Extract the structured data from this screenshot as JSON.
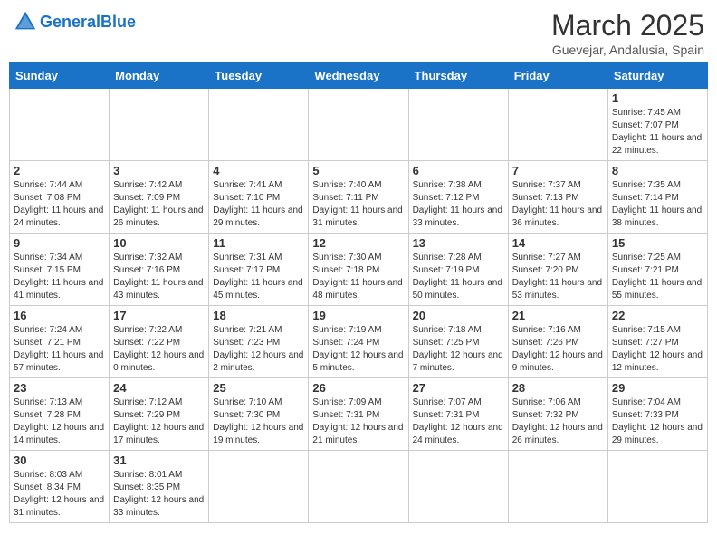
{
  "header": {
    "logo_text_general": "General",
    "logo_text_blue": "Blue",
    "month": "March 2025",
    "location": "Guevejar, Andalusia, Spain"
  },
  "days_of_week": [
    "Sunday",
    "Monday",
    "Tuesday",
    "Wednesday",
    "Thursday",
    "Friday",
    "Saturday"
  ],
  "weeks": [
    [
      {
        "day": "",
        "info": ""
      },
      {
        "day": "",
        "info": ""
      },
      {
        "day": "",
        "info": ""
      },
      {
        "day": "",
        "info": ""
      },
      {
        "day": "",
        "info": ""
      },
      {
        "day": "",
        "info": ""
      },
      {
        "day": "1",
        "info": "Sunrise: 7:45 AM\nSunset: 7:07 PM\nDaylight: 11 hours\nand 22 minutes."
      }
    ],
    [
      {
        "day": "2",
        "info": "Sunrise: 7:44 AM\nSunset: 7:08 PM\nDaylight: 11 hours\nand 24 minutes."
      },
      {
        "day": "3",
        "info": "Sunrise: 7:42 AM\nSunset: 7:09 PM\nDaylight: 11 hours\nand 26 minutes."
      },
      {
        "day": "4",
        "info": "Sunrise: 7:41 AM\nSunset: 7:10 PM\nDaylight: 11 hours\nand 29 minutes."
      },
      {
        "day": "5",
        "info": "Sunrise: 7:40 AM\nSunset: 7:11 PM\nDaylight: 11 hours\nand 31 minutes."
      },
      {
        "day": "6",
        "info": "Sunrise: 7:38 AM\nSunset: 7:12 PM\nDaylight: 11 hours\nand 33 minutes."
      },
      {
        "day": "7",
        "info": "Sunrise: 7:37 AM\nSunset: 7:13 PM\nDaylight: 11 hours\nand 36 minutes."
      },
      {
        "day": "8",
        "info": "Sunrise: 7:35 AM\nSunset: 7:14 PM\nDaylight: 11 hours\nand 38 minutes."
      }
    ],
    [
      {
        "day": "9",
        "info": "Sunrise: 7:34 AM\nSunset: 7:15 PM\nDaylight: 11 hours\nand 41 minutes."
      },
      {
        "day": "10",
        "info": "Sunrise: 7:32 AM\nSunset: 7:16 PM\nDaylight: 11 hours\nand 43 minutes."
      },
      {
        "day": "11",
        "info": "Sunrise: 7:31 AM\nSunset: 7:17 PM\nDaylight: 11 hours\nand 45 minutes."
      },
      {
        "day": "12",
        "info": "Sunrise: 7:30 AM\nSunset: 7:18 PM\nDaylight: 11 hours\nand 48 minutes."
      },
      {
        "day": "13",
        "info": "Sunrise: 7:28 AM\nSunset: 7:19 PM\nDaylight: 11 hours\nand 50 minutes."
      },
      {
        "day": "14",
        "info": "Sunrise: 7:27 AM\nSunset: 7:20 PM\nDaylight: 11 hours\nand 53 minutes."
      },
      {
        "day": "15",
        "info": "Sunrise: 7:25 AM\nSunset: 7:21 PM\nDaylight: 11 hours\nand 55 minutes."
      }
    ],
    [
      {
        "day": "16",
        "info": "Sunrise: 7:24 AM\nSunset: 7:21 PM\nDaylight: 11 hours\nand 57 minutes."
      },
      {
        "day": "17",
        "info": "Sunrise: 7:22 AM\nSunset: 7:22 PM\nDaylight: 12 hours\nand 0 minutes."
      },
      {
        "day": "18",
        "info": "Sunrise: 7:21 AM\nSunset: 7:23 PM\nDaylight: 12 hours\nand 2 minutes."
      },
      {
        "day": "19",
        "info": "Sunrise: 7:19 AM\nSunset: 7:24 PM\nDaylight: 12 hours\nand 5 minutes."
      },
      {
        "day": "20",
        "info": "Sunrise: 7:18 AM\nSunset: 7:25 PM\nDaylight: 12 hours\nand 7 minutes."
      },
      {
        "day": "21",
        "info": "Sunrise: 7:16 AM\nSunset: 7:26 PM\nDaylight: 12 hours\nand 9 minutes."
      },
      {
        "day": "22",
        "info": "Sunrise: 7:15 AM\nSunset: 7:27 PM\nDaylight: 12 hours\nand 12 minutes."
      }
    ],
    [
      {
        "day": "23",
        "info": "Sunrise: 7:13 AM\nSunset: 7:28 PM\nDaylight: 12 hours\nand 14 minutes."
      },
      {
        "day": "24",
        "info": "Sunrise: 7:12 AM\nSunset: 7:29 PM\nDaylight: 12 hours\nand 17 minutes."
      },
      {
        "day": "25",
        "info": "Sunrise: 7:10 AM\nSunset: 7:30 PM\nDaylight: 12 hours\nand 19 minutes."
      },
      {
        "day": "26",
        "info": "Sunrise: 7:09 AM\nSunset: 7:31 PM\nDaylight: 12 hours\nand 21 minutes."
      },
      {
        "day": "27",
        "info": "Sunrise: 7:07 AM\nSunset: 7:31 PM\nDaylight: 12 hours\nand 24 minutes."
      },
      {
        "day": "28",
        "info": "Sunrise: 7:06 AM\nSunset: 7:32 PM\nDaylight: 12 hours\nand 26 minutes."
      },
      {
        "day": "29",
        "info": "Sunrise: 7:04 AM\nSunset: 7:33 PM\nDaylight: 12 hours\nand 29 minutes."
      }
    ],
    [
      {
        "day": "30",
        "info": "Sunrise: 8:03 AM\nSunset: 8:34 PM\nDaylight: 12 hours\nand 31 minutes."
      },
      {
        "day": "31",
        "info": "Sunrise: 8:01 AM\nSunset: 8:35 PM\nDaylight: 12 hours\nand 33 minutes."
      },
      {
        "day": "",
        "info": ""
      },
      {
        "day": "",
        "info": ""
      },
      {
        "day": "",
        "info": ""
      },
      {
        "day": "",
        "info": ""
      },
      {
        "day": "",
        "info": ""
      }
    ]
  ]
}
